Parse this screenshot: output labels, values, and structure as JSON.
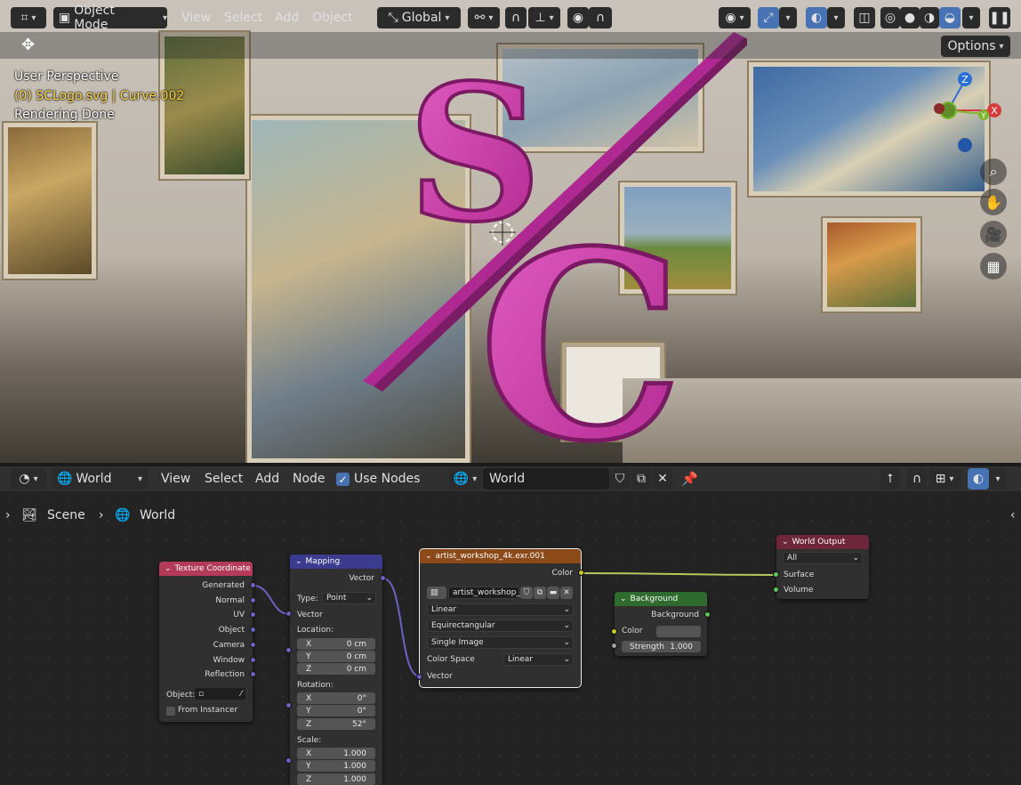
{
  "viewport": {
    "mode": "Object Mode",
    "menus": [
      "View",
      "Select",
      "Add",
      "Object"
    ],
    "transform": "Global",
    "options_label": "Options",
    "overlay_lines": [
      "User Perspective",
      "(0) SCLogo.svg | Curve.002",
      "Rendering Done"
    ],
    "gizmo": {
      "z": "Z",
      "x": "X",
      "y": "Y"
    },
    "nav_icons": [
      "zoom-icon",
      "hand-icon",
      "camera-icon",
      "grid-icon"
    ]
  },
  "node_editor": {
    "type": "World",
    "menus": [
      "View",
      "Select",
      "Add",
      "Node"
    ],
    "use_nodes_label": "Use Nodes",
    "datablock": "World",
    "breadcrumb": {
      "scene": "Scene",
      "world": "World"
    }
  },
  "nodes": {
    "texcoord": {
      "title": "Texture Coordinate",
      "outputs": [
        "Generated",
        "Normal",
        "UV",
        "Object",
        "Camera",
        "Window",
        "Reflection"
      ],
      "object_label": "Object:",
      "from_instancer": "From Instancer"
    },
    "mapping": {
      "title": "Mapping",
      "output": "Vector",
      "type_label": "Type:",
      "type_value": "Point",
      "input": "Vector",
      "location_label": "Location:",
      "location": [
        {
          "a": "X",
          "v": "0 cm"
        },
        {
          "a": "Y",
          "v": "0 cm"
        },
        {
          "a": "Z",
          "v": "0 cm"
        }
      ],
      "rotation_label": "Rotation:",
      "rotation": [
        {
          "a": "X",
          "v": "0°"
        },
        {
          "a": "Y",
          "v": "0°"
        },
        {
          "a": "Z",
          "v": "52°"
        }
      ],
      "scale_label": "Scale:",
      "scale": [
        {
          "a": "X",
          "v": "1.000"
        },
        {
          "a": "Y",
          "v": "1.000"
        },
        {
          "a": "Z",
          "v": "1.000"
        }
      ]
    },
    "env": {
      "title": "artist_workshop_4k.exr.001",
      "output": "Color",
      "image": "artist_workshop_...",
      "interp": "Linear",
      "projection": "Equirectangular",
      "source": "Single Image",
      "colorspace_label": "Color Space",
      "colorspace": "Linear",
      "input": "Vector"
    },
    "background": {
      "title": "Background",
      "output": "Background",
      "color_label": "Color",
      "strength_label": "Strength",
      "strength": "1.000"
    },
    "output": {
      "title": "World Output",
      "target": "All",
      "surface": "Surface",
      "volume": "Volume"
    }
  },
  "colors": {
    "accent": "#4772b3",
    "logo": "#d23fb0",
    "texcoord_header": "#b33a59",
    "mapping_header": "#3b3c8f",
    "env_header": "#8c4a18",
    "bg_header": "#2f6b2e",
    "output_header": "#70263a"
  }
}
